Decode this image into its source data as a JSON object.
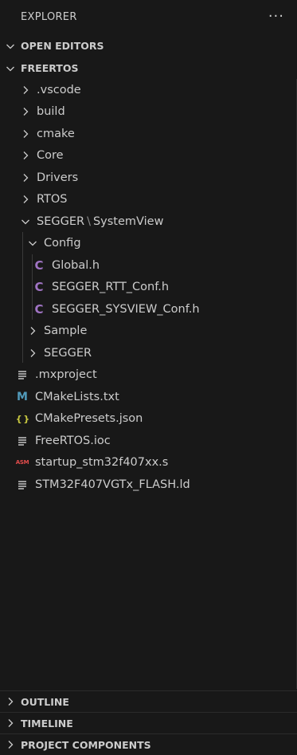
{
  "explorer": {
    "title": "EXPLORER",
    "more_icon": "···"
  },
  "open_editors": {
    "label": "OPEN EDITORS"
  },
  "project": {
    "label": "FREERTOS"
  },
  "tree": {
    "vscode": ".vscode",
    "build": "build",
    "cmake": "cmake",
    "core": "Core",
    "drivers": "Drivers",
    "rtos": "RTOS",
    "segger_a": "SEGGER",
    "segger_sep": "\\",
    "segger_b": "SystemView",
    "config": "Config",
    "global_h": "Global.h",
    "rtt_conf": "SEGGER_RTT_Conf.h",
    "sysview_conf": "SEGGER_SYSVIEW_Conf.h",
    "sample": "Sample",
    "segger": "SEGGER",
    "mxproject": ".mxproject",
    "cmakelists": "CMakeLists.txt",
    "cmakepresets": "CMakePresets.json",
    "ioc": "FreeRTOS.ioc",
    "startup": "startup_stm32f407xx.s",
    "ld": "STM32F407VGTx_FLASH.ld",
    "icon_c": "C",
    "icon_m": "M",
    "icon_json": "{ }",
    "icon_asm": "ASM"
  },
  "outline": {
    "label": "OUTLINE"
  },
  "timeline": {
    "label": "TIMELINE"
  },
  "project_components": {
    "label": "PROJECT COMPONENTS"
  },
  "colors": {
    "background": "#181818",
    "c_icon": "#a074c4",
    "m_icon": "#519aba",
    "json_icon": "#cbcb41",
    "asm_icon": "#e34c4c"
  }
}
